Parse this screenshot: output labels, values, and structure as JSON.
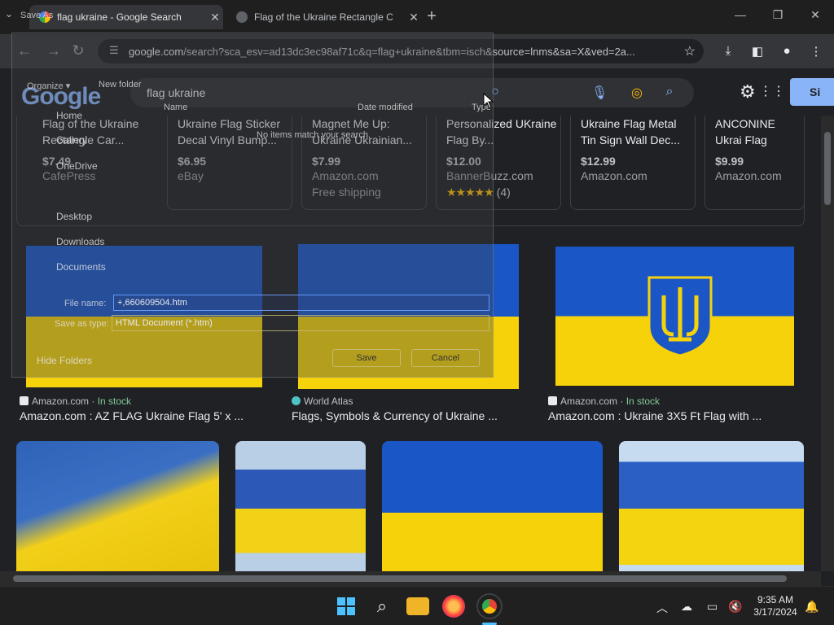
{
  "tabs": [
    {
      "title": "flag ukraine - Google Search"
    },
    {
      "title": "Flag of the Ukraine Rectangle C"
    }
  ],
  "toolbar": {
    "url_host": "google.com",
    "url_rest": "/search?sca_esv=ad13dc3ec98af71c&q=flag+ukraine&tbm=isch&source=lnms&sa=X&ved=2a..."
  },
  "google": {
    "logo": "Google",
    "query": "flag ukraine",
    "signin_label": "Si"
  },
  "shopping": [
    {
      "title": "Flag of the Ukraine Rectangle Car...",
      "price": "$7.49",
      "store": "CafePress"
    },
    {
      "title": "Ukraine Flag Sticker Decal Vinyl Bump...",
      "price": "$6.95",
      "store": "eBay"
    },
    {
      "title": "Magnet Me Up: Ukraine Ukrainian...",
      "price": "$7.99",
      "store": "Amazon.com",
      "extra": "Free shipping"
    },
    {
      "title": "Personalized UKraine Flag By...",
      "price": "$12.00",
      "store": "BannerBuzz.com",
      "rating": "★★★★★",
      "reviews": "(4)"
    },
    {
      "title": "Ukraine Flag Metal Tin Sign Wall Dec...",
      "price": "$12.99",
      "store": "Amazon.com"
    },
    {
      "title": "ANCONINE Ukrai Flag Ukrainian wi",
      "price": "$9.99",
      "store": "Amazon.com"
    }
  ],
  "results": [
    {
      "source": "Amazon.com",
      "stock": "In stock",
      "title": "Amazon.com : AZ FLAG Ukraine Flag 5' x ..."
    },
    {
      "source": "World Atlas",
      "title": "Flags, Symbols & Currency of Ukraine ..."
    },
    {
      "source": "Amazon.com",
      "stock": "In stock",
      "title": "Amazon.com : Ukraine 3X5 Ft Flag with ..."
    }
  ],
  "save_dialog": {
    "title": "Save As",
    "organize": "Organize ▾",
    "new_folder": "New folder",
    "col_name": "Name",
    "col_date": "Date modified",
    "col_type": "Type",
    "empty_msg": "No items match your search.",
    "nav": [
      "Home",
      "Gallery",
      "OneDrive",
      "Desktop",
      "Downloads",
      "Documents"
    ],
    "file_name_label": "File name:",
    "file_name_value": "+,660609504.htm",
    "save_type_label": "Save as type:",
    "save_type_value": "HTML Document (*.htm)",
    "save_label": "Save",
    "cancel_label": "Cancel",
    "hide_folders": "Hide Folders"
  },
  "clock": {
    "time": "9:35 AM",
    "date": "3/17/2024"
  },
  "colors": {
    "blue": "#1b56c7",
    "yellow": "#f5d20a",
    "accent": "#8ab4f8"
  }
}
